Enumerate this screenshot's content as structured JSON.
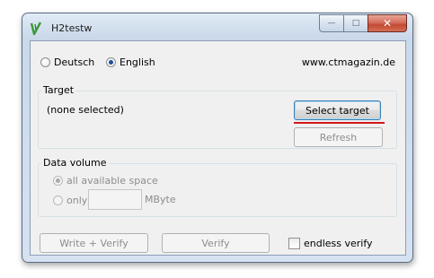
{
  "window": {
    "title": "H2testw",
    "minimize_label": "—",
    "maximize_label": "□",
    "close_label": "✕"
  },
  "language": {
    "options": [
      "Deutsch",
      "English"
    ],
    "selected": "English",
    "website": "www.ctmagazin.de"
  },
  "target": {
    "legend": "Target",
    "value": "(none selected)",
    "select_label": "Select target",
    "refresh_label": "Refresh"
  },
  "data_volume": {
    "legend": "Data volume",
    "all_space_label": "all available space",
    "only_label": "only",
    "only_value": "",
    "unit": "MByte"
  },
  "actions": {
    "write_verify_label": "Write + Verify",
    "verify_label": "Verify",
    "endless_label": "endless verify"
  },
  "colors": {
    "highlight_underline": "#d01919",
    "close_button": "#c24a33"
  }
}
